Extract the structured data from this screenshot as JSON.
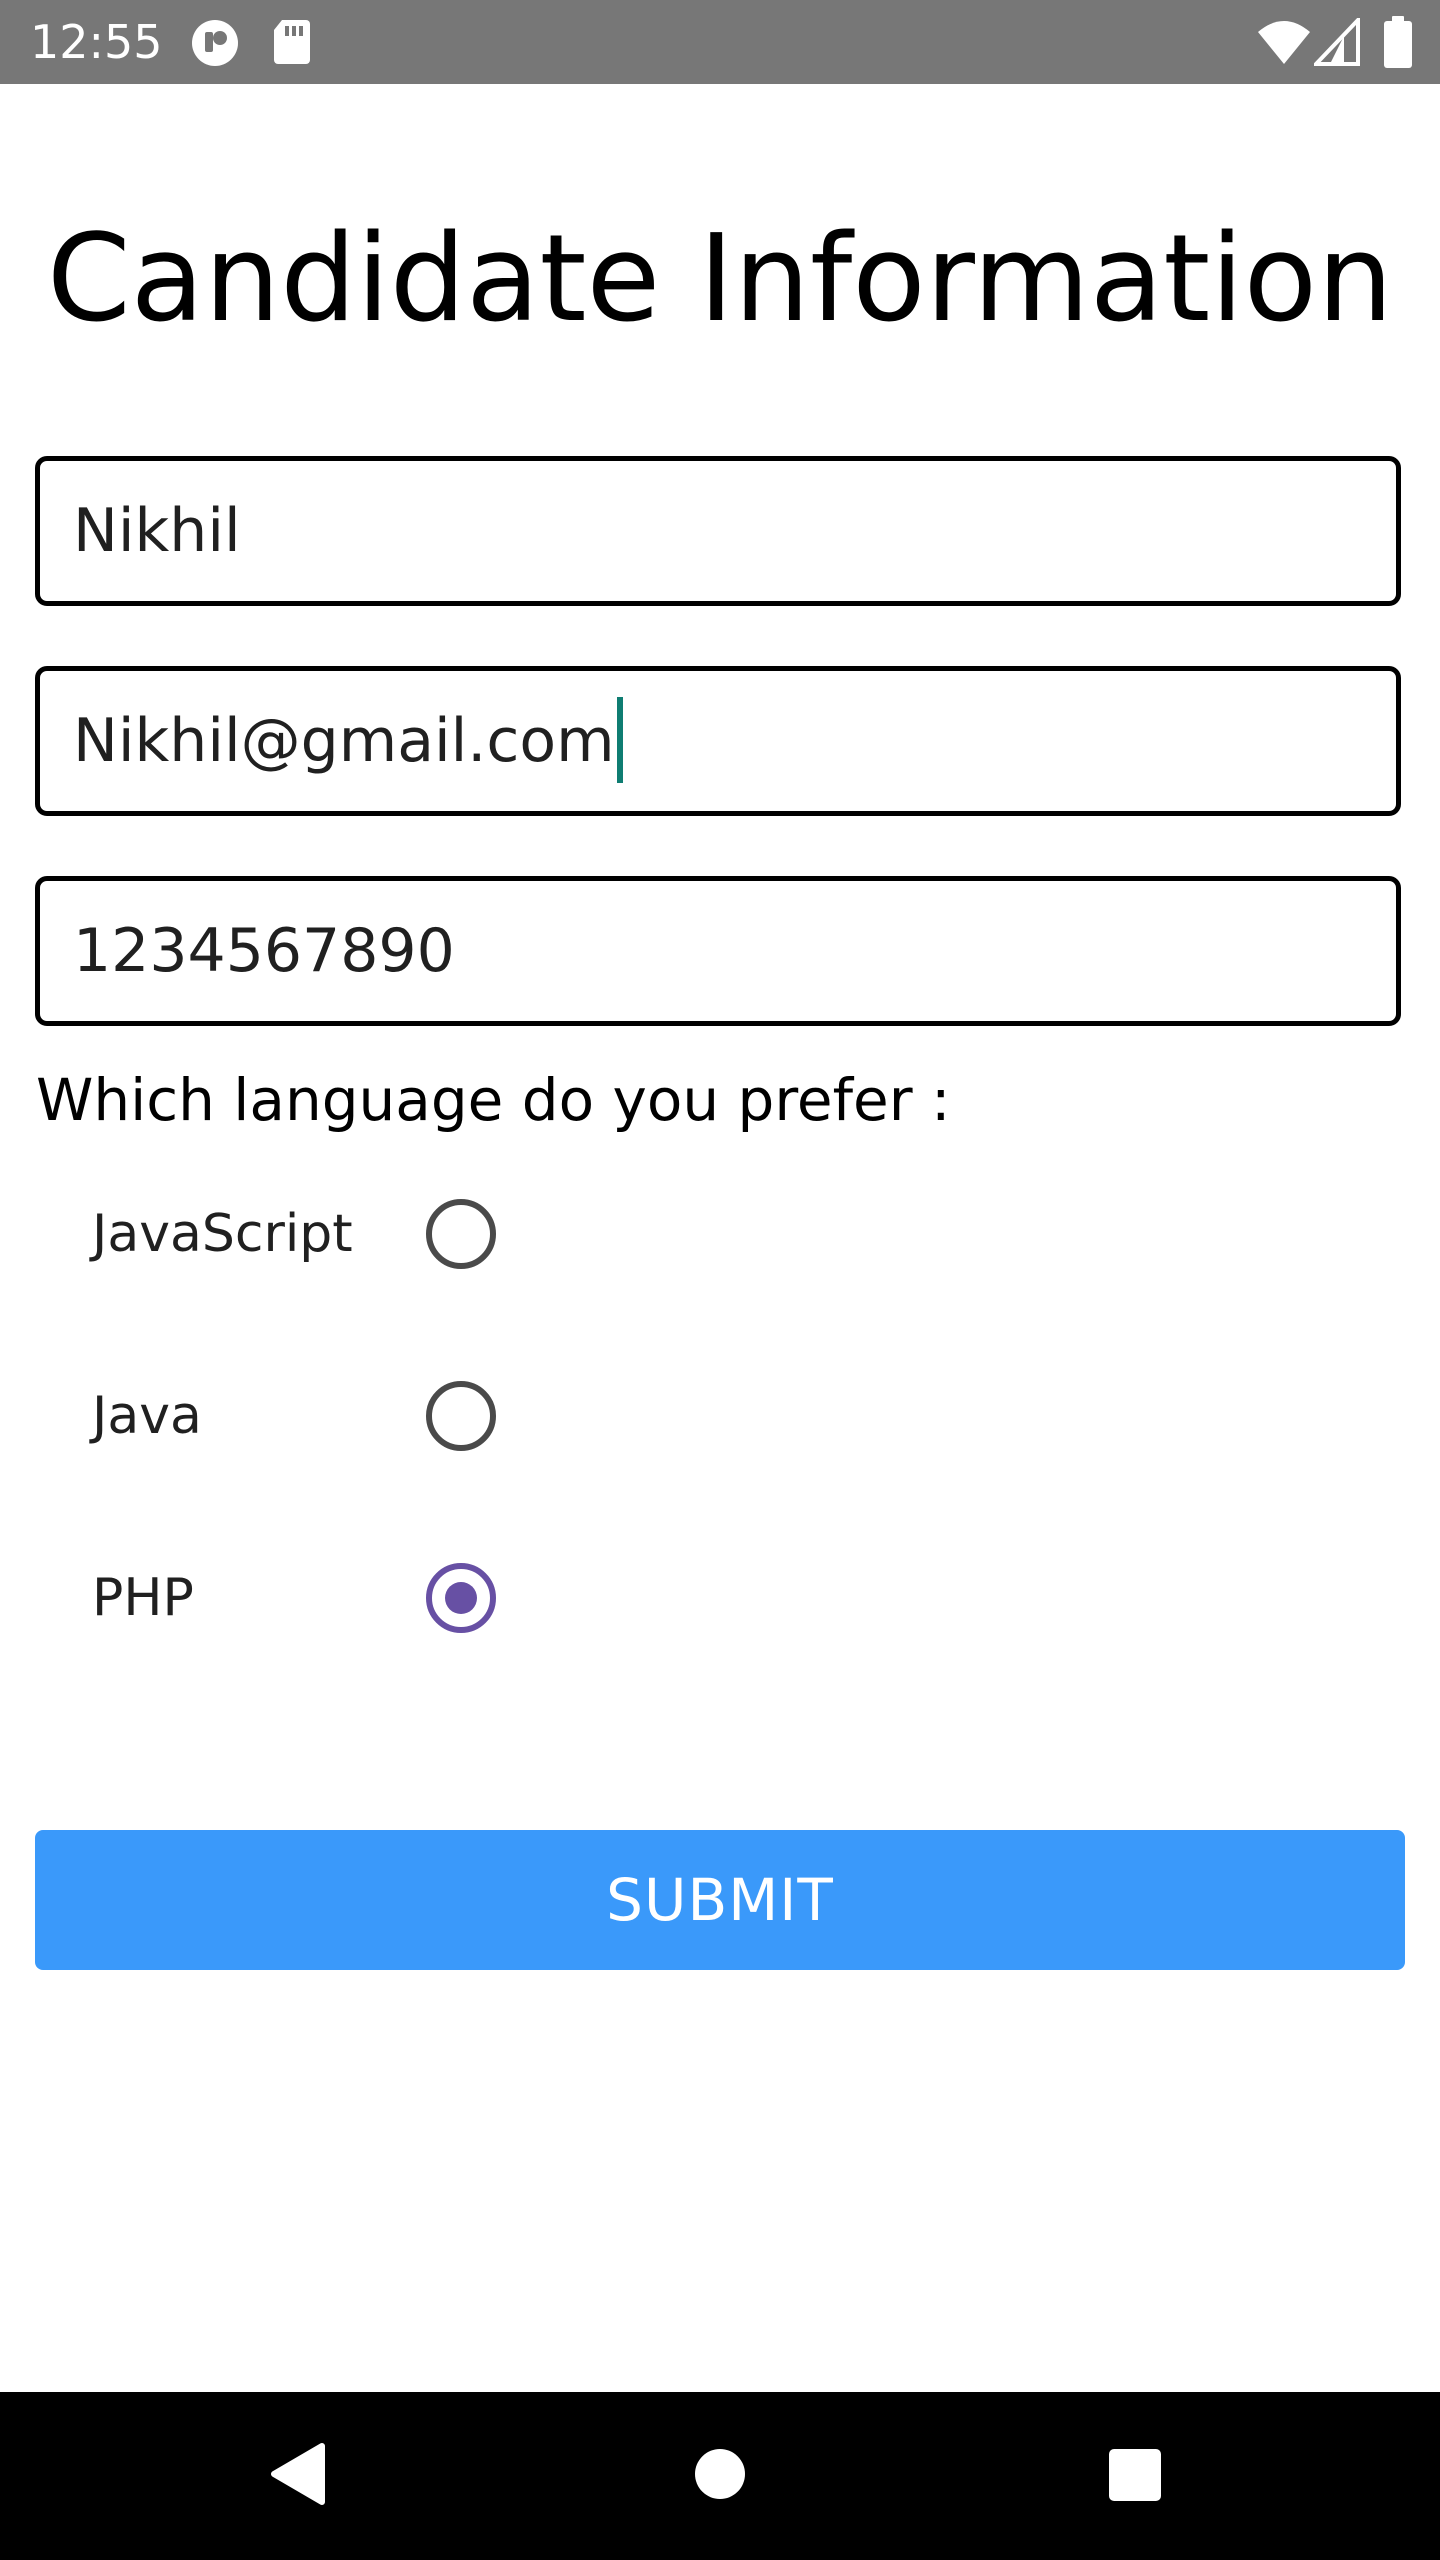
{
  "status_bar": {
    "time": "12:55",
    "left_icons": [
      "media-icon",
      "sd-card-icon"
    ],
    "right_icons": [
      "wifi-icon",
      "signal-icon",
      "battery-icon"
    ]
  },
  "title": "Candidate Information",
  "form": {
    "name_value": "Nikhil",
    "email_value": "Nikhil@gmail.com",
    "phone_value": "1234567890"
  },
  "question": "Which language do you prefer :",
  "options": [
    {
      "label": "JavaScript",
      "selected": false
    },
    {
      "label": "Java",
      "selected": false
    },
    {
      "label": "PHP",
      "selected": true
    }
  ],
  "submit_label": "SUBMIT",
  "colors": {
    "status_bar": "#777777",
    "accent_radio": "#6750a4",
    "submit_button": "#3a99fa",
    "caret": "#0f7d72",
    "nav_bar": "#000000"
  },
  "nav_bar": {
    "buttons": [
      "back-icon",
      "home-icon",
      "recents-icon"
    ]
  }
}
